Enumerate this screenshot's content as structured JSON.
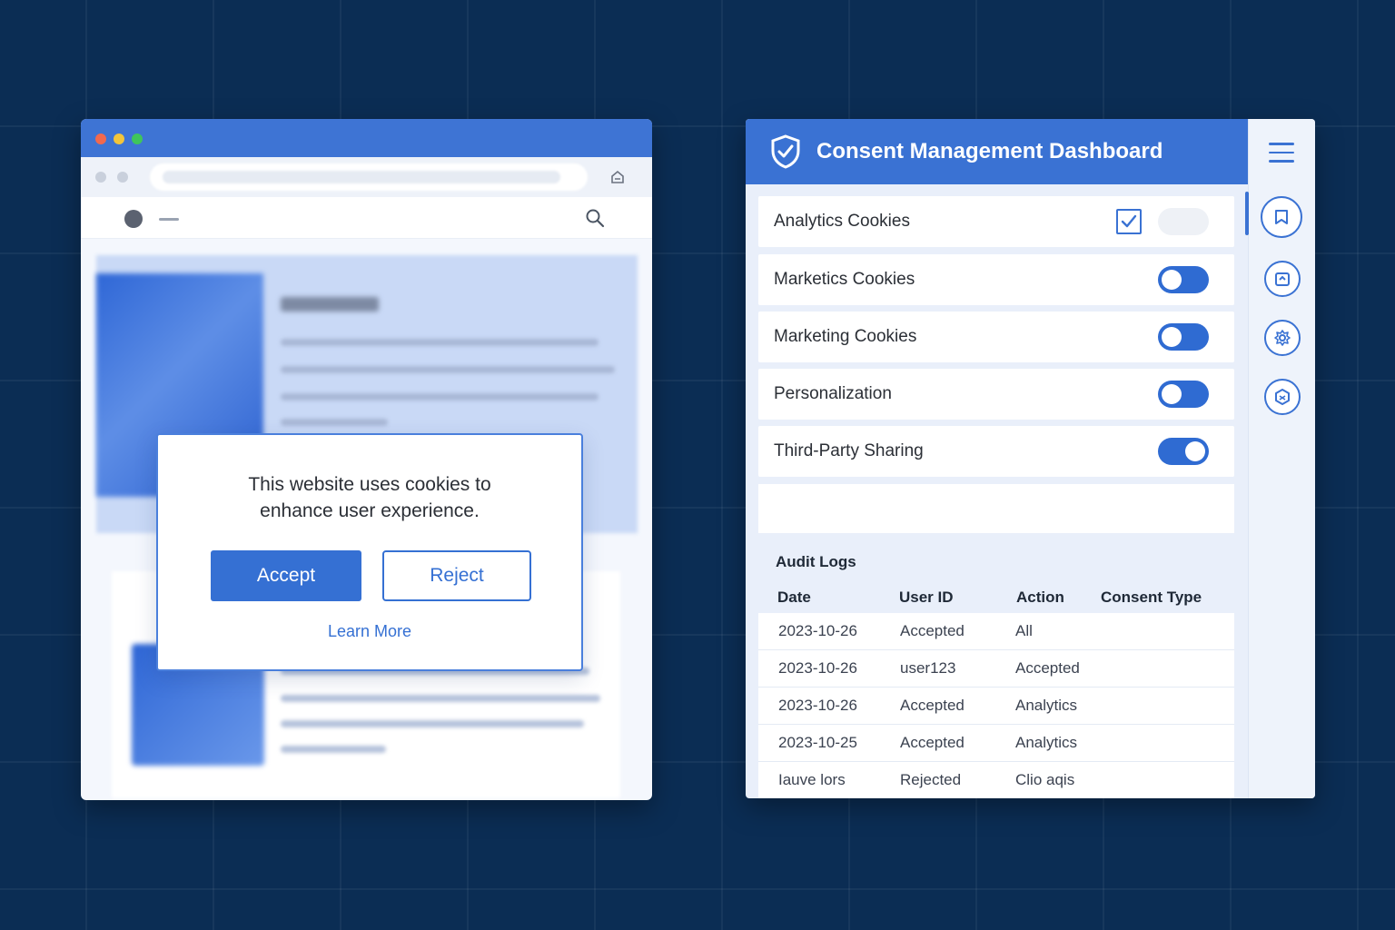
{
  "cookie_banner": {
    "message": "This website uses cookies to enhance user experience.",
    "accept_label": "Accept",
    "reject_label": "Reject",
    "learn_more_label": "Learn More"
  },
  "dashboard": {
    "title": "Consent Management Dashboard",
    "toggles": [
      {
        "label": "Analytics Cookies",
        "control": "checkbox",
        "checked": true
      },
      {
        "label": "Marketics Cookies",
        "control": "switch",
        "on": false
      },
      {
        "label": "Marketing Cookies",
        "control": "switch",
        "on": false
      },
      {
        "label": "Personalization",
        "control": "switch",
        "on": false
      },
      {
        "label": "Third-Party Sharing",
        "control": "switch",
        "on": true
      }
    ],
    "audit_logs": {
      "title": "Audit Logs",
      "columns": [
        "Date",
        "User ID",
        "Action",
        "Consent Type"
      ],
      "rows": [
        [
          "2023-10-26",
          "Accepted",
          "All",
          ""
        ],
        [
          "2023-10-26",
          "user123",
          "Accepted",
          ""
        ],
        [
          "2023-10-26",
          "Accepted",
          "Analytics",
          ""
        ],
        [
          "2023-10-25",
          "Accepted",
          "Analytics",
          ""
        ],
        [
          "Iauve lors",
          "Rejected",
          "Clio aqis",
          ""
        ]
      ]
    }
  },
  "colors": {
    "background": "#0b2d54",
    "accent": "#3a72d3",
    "dot_red": "#f2694e",
    "dot_yellow": "#f3c53b",
    "dot_green": "#3fc55b"
  },
  "icons": {
    "header": "shield-check-icon",
    "menu": "hamburger-menu-icon",
    "rail": [
      "bookmark-icon",
      "calendar-icon",
      "settings-icon",
      "hexagon-icon"
    ]
  }
}
